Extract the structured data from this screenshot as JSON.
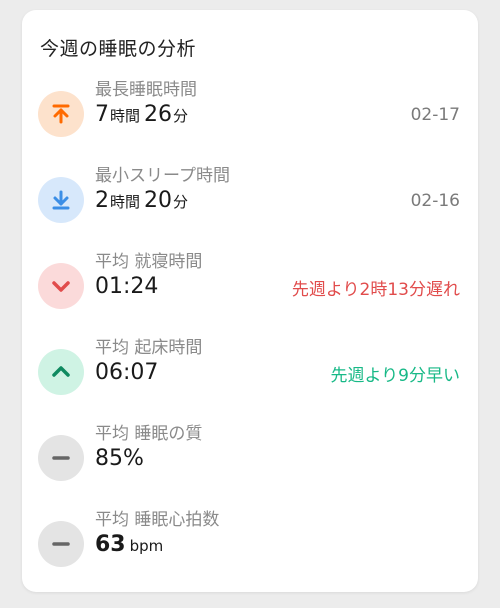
{
  "card": {
    "title": "今週の睡眠の分析"
  },
  "rows": [
    {
      "label": "最長睡眠時間",
      "hours": "7",
      "hours_unit": "時間",
      "minutes": "26",
      "minutes_unit": "分",
      "right_text": "02-17",
      "icon": "arrow-up-to-line-icon",
      "icon_color": "#ff6a00",
      "icon_bg": "#fde2cc"
    },
    {
      "label": "最小スリープ時間",
      "hours": "2",
      "hours_unit": "時間",
      "minutes": "20",
      "minutes_unit": "分",
      "right_text": "02-16",
      "icon": "arrow-down-to-line-icon",
      "icon_color": "#3b8ee6",
      "icon_bg": "#d7e8fb"
    },
    {
      "label": "平均 就寝時間",
      "value": "01:24",
      "right_text": "先週より2時13分遅れ",
      "icon": "chevron-down-icon",
      "icon_color": "#e14c4c",
      "icon_bg": "#fbdada"
    },
    {
      "label": "平均 起床時間",
      "value": "06:07",
      "right_text": "先週より9分早い",
      "icon": "chevron-up-icon",
      "icon_color": "#0f8a60",
      "icon_bg": "#cff3e4"
    },
    {
      "label": "平均 睡眠の質",
      "value": "85%",
      "icon": "minus-icon",
      "icon_color": "#666666",
      "icon_bg": "#e4e4e4"
    },
    {
      "label": "平均 睡眠心拍数",
      "value": "63",
      "unit": "bpm",
      "icon": "minus-icon",
      "icon_color": "#666666",
      "icon_bg": "#e4e4e4"
    }
  ]
}
